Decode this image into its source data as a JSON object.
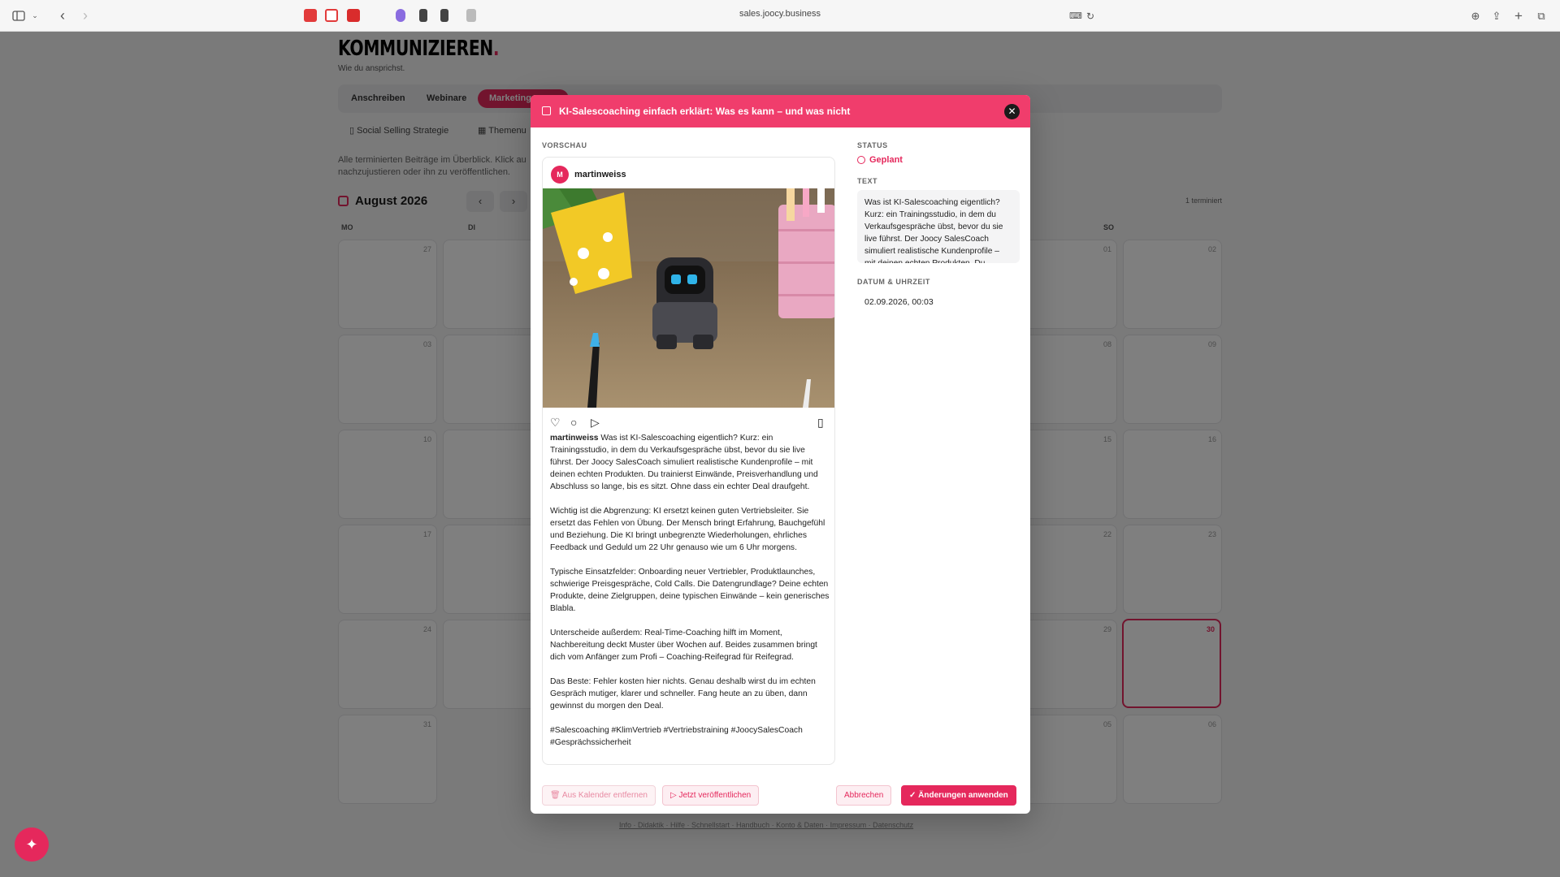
{
  "browser": {
    "url": "sales.joocy.business"
  },
  "page": {
    "title": "KOMMUNIZIEREN",
    "title_dot": ".",
    "subtitle": "Wie du ansprichst.",
    "tabs": [
      "Anschreiben",
      "Webinare",
      "Marketing"
    ],
    "subtabs": [
      "Social Selling Strategie",
      "Themenu"
    ],
    "description": "Alle terminierten Beiträge im Überblick. Klick au nachzujustieren oder ihn zu veröffentlichen.",
    "month": "August 2026",
    "terminated_count": "1 terminiert",
    "weekdays": {
      "mo": "MO",
      "di": "DI",
      "so": "SO"
    },
    "calendar_left": [
      "27",
      "03",
      "10",
      "17",
      "24",
      "31"
    ],
    "calendar_right_sa": [
      "01",
      "08",
      "15",
      "22",
      "29",
      "05"
    ],
    "calendar_right_so": [
      "02",
      "09",
      "16",
      "23",
      "30",
      "06"
    ],
    "footer_links": "Info · Didaktik · Hilfe · Schnellstart · Handbuch · Konto & Daten · Impressum · Datenschutz"
  },
  "modal": {
    "title": "KI-Salescoaching einfach erklärt: Was es kann – und was nicht",
    "preview_label": "VORSCHAU",
    "avatar_letter": "M",
    "username": "martinweiss",
    "caption": {
      "user": "martinweiss",
      "p1": "Was ist KI-Salescoaching eigentlich? Kurz: ein Trainingsstudio, in dem du Verkaufsgespräche übst, bevor du sie live führst. Der Joocy SalesCoach simuliert realistische Kundenprofile – mit deinen echten Produkten. Du trainierst Einwände, Preisverhandlung und Abschluss so lange, bis es sitzt. Ohne dass ein echter Deal draufgeht.",
      "p2": "Wichtig ist die Abgrenzung: KI ersetzt keinen guten Vertriebsleiter. Sie ersetzt das Fehlen von Übung. Der Mensch bringt Erfahrung, Bauchgefühl und Beziehung. Die KI bringt unbegrenzte Wiederholungen, ehrliches Feedback und Geduld um 22 Uhr genauso wie um 6 Uhr morgens.",
      "p3": "Typische Einsatzfelder: Onboarding neuer Vertriebler, Produktlaunches, schwierige Preisgespräche, Cold Calls. Die Datengrundlage? Deine echten Produkte, deine Zielgruppen, deine typischen Einwände – kein generisches Blabla.",
      "p4": "Unterscheide außerdem: Real-Time-Coaching hilft im Moment, Nachbereitung deckt Muster über Wochen auf. Beides zusammen bringt dich vom Anfänger zum Profi – Coaching-Reifegrad für Reifegrad.",
      "p5": "Das Beste: Fehler kosten hier nichts. Genau deshalb wirst du im echten Gespräch mutiger, klarer und schneller. Fang heute an zu üben, dann gewinnst du morgen den Deal.",
      "p6": "#Salescoaching #KlimVertrieb #Vertriebstraining #JoocySalesCoach #Gesprächssicherheit"
    },
    "status_label": "STATUS",
    "status_value": "Geplant",
    "text_label": "TEXT",
    "text_value": "Was ist KI-Salescoaching eigentlich? Kurz: ein Trainingsstudio, in dem du Verkaufsgespräche übst, bevor du sie live führst. Der Joocy SalesCoach simuliert realistische Kundenprofile – mit deinen echten Produkten. Du",
    "datetime_label": "DATUM & UHRZEIT",
    "datetime_value": "02.09.2026, 00:03",
    "buttons": {
      "remove": "Aus Kalender entfernen",
      "publish": "Jetzt veröffentlichen",
      "cancel": "Abbrechen",
      "apply": "Änderungen anwenden"
    }
  },
  "colors": {
    "accent": "#e5285c",
    "header": "#f03d6c"
  }
}
